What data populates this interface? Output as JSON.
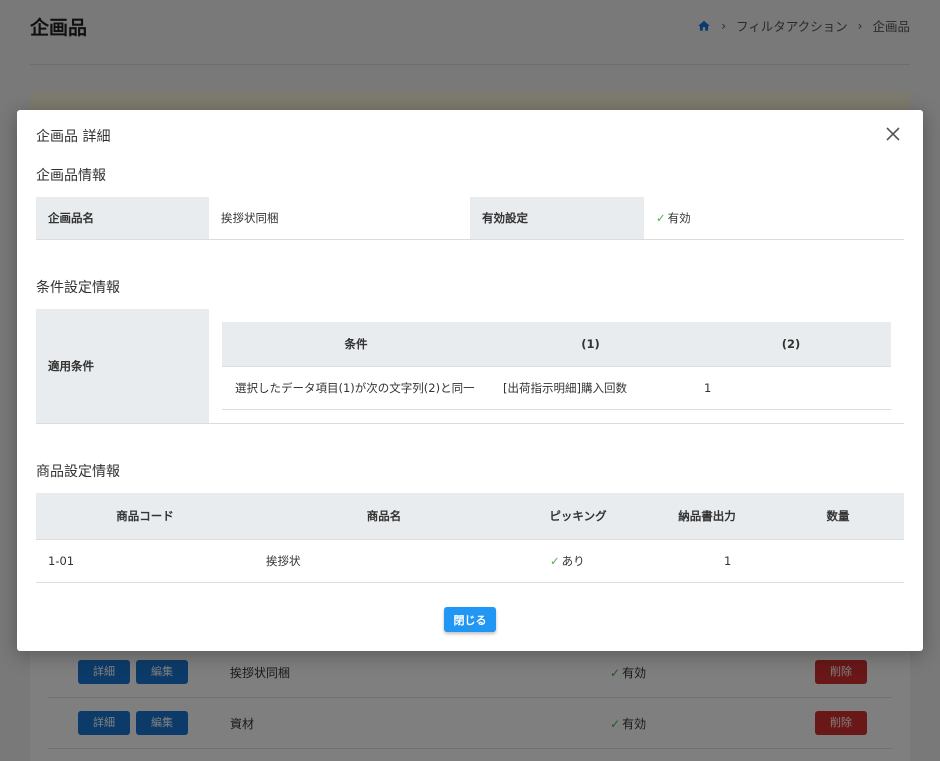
{
  "page": {
    "title": "企画品",
    "breadcrumb": [
      "フィルタアクション",
      "企画品"
    ]
  },
  "background_rows": [
    {
      "detail": "詳細",
      "edit": "編集",
      "name": "挨拶状同梱",
      "status": "有効",
      "delete": "削除"
    },
    {
      "detail": "詳細",
      "edit": "編集",
      "name": "資材",
      "status": "有効",
      "delete": "削除"
    }
  ],
  "modal": {
    "title": "企画品 詳細",
    "plan_section": {
      "title": "企画品情報",
      "name_label": "企画品名",
      "name_value": "挨拶状同梱",
      "enabled_label": "有効設定",
      "enabled_value": "有効"
    },
    "condition_section": {
      "title": "条件設定情報",
      "label": "適用条件",
      "headers": [
        "条件",
        "(1)",
        "(2)"
      ],
      "rows": [
        [
          "選択したデータ項目(1)が次の文字列(2)と同一",
          "[出荷指示明細]購入回数",
          "1"
        ]
      ]
    },
    "product_section": {
      "title": "商品設定情報",
      "headers": [
        "商品コード",
        "商品名",
        "ピッキング",
        "納品書出力",
        "数量"
      ],
      "rows": [
        {
          "code": "1-01",
          "name": "挨拶状",
          "picking": "あり",
          "slip": "",
          "qty": "1"
        }
      ]
    },
    "close_label": "閉じる"
  },
  "colors": {
    "primary": "#2196f3",
    "danger": "#d32f2f",
    "header_bg": "#e9ecef",
    "check": "#4caf50"
  }
}
